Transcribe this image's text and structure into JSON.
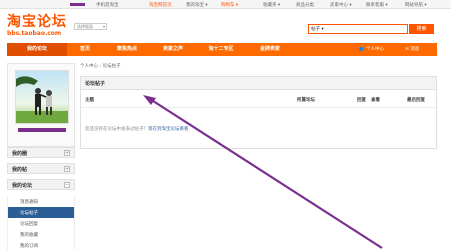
{
  "topbar": {
    "links": [
      "手机逛淘宝",
      "淘宝网首页",
      "我的淘宝 ▾",
      "购物车 ▾",
      "收藏夹 ▾",
      "商品分类",
      "卖家中心 ▾",
      "联系客服 ▾",
      "网站导航 ▾"
    ]
  },
  "logo": {
    "title": "淘宝论坛",
    "url": "bbs.taobao.com"
  },
  "forum_select": {
    "value": "选择版面"
  },
  "search": {
    "type_value": "帖子 ▾",
    "placeholder": "",
    "button": "搜索"
  },
  "nav": {
    "items": [
      "我的论坛",
      "首页",
      "聚焦热点",
      "卖家之声",
      "淘十二专区",
      "金牌卖家"
    ],
    "right": [
      "个人中心",
      "消息"
    ]
  },
  "sidebar": {
    "groups": [
      {
        "label": "我的圈",
        "toggle": "+"
      },
      {
        "label": "我的帖",
        "toggle": "+"
      },
      {
        "label": "我的论坛",
        "toggle": "−"
      }
    ],
    "sub_items": [
      "消息通知",
      "论坛帖子",
      "论坛回复",
      "我的收藏",
      "我的订阅"
    ]
  },
  "main": {
    "breadcrumb": "个人中心 › 论坛帖子",
    "panel_title": "论坛帖子",
    "columns": [
      "主题",
      "所属论坛",
      "回复",
      "查看",
      "最后回复"
    ],
    "empty_prefix": "您还没有在论坛中发表过帖子！",
    "empty_link": "现在到淘宝论坛看看"
  },
  "colors": {
    "brand": "#ff5500",
    "nav": "#ff6a00",
    "active": "#2b5e97",
    "annotation_arrow": "#7a2f8f"
  }
}
